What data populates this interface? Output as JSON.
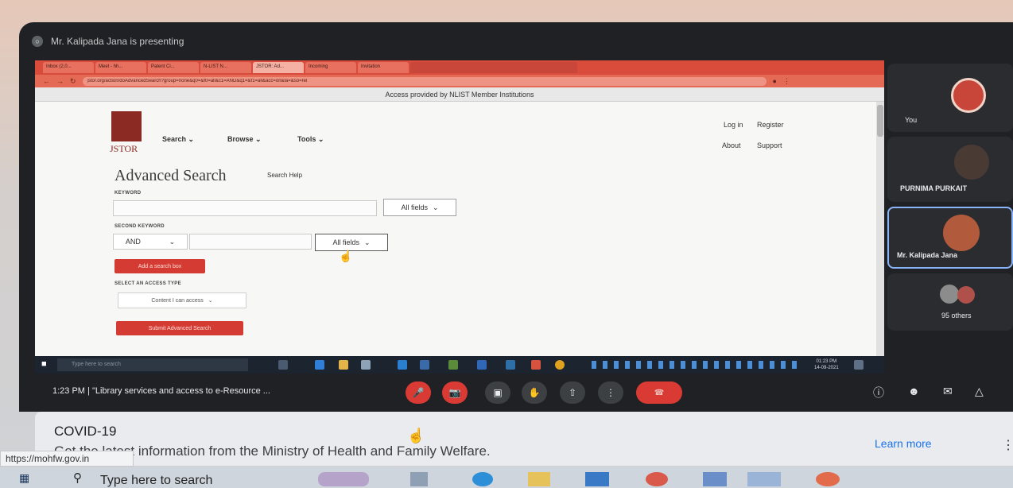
{
  "meet": {
    "presenting_text": "Mr. Kalipada Jana is presenting",
    "meeting_time": "1:23 PM",
    "meeting_separator": "|",
    "meeting_title": "\"Library services and access to e-Resource ...",
    "participants": [
      {
        "name": "You"
      },
      {
        "name": "PURNIMA PURKAIT"
      },
      {
        "name": "Mr. Kalipada Jana"
      },
      {
        "name": "95 others"
      }
    ],
    "end_call_label": "☎"
  },
  "browser": {
    "tabs": [
      "Inbox (2,0...",
      "Meet - hh...",
      "Patent Ci...",
      "N-LIST N...",
      "JSTOR: Ad...",
      "Incoming",
      "Invitation",
      ""
    ],
    "url": "jstor.org/action/doAdvancedSearch?group=none&q0=&f0=all&c1=AND&q1=&f1=all&acc=on&la=&so=rel"
  },
  "jstor": {
    "access_banner": "Access provided by NLIST Member Institutions",
    "logo_text": "JSTOR",
    "nav": {
      "search": "Search",
      "browse": "Browse",
      "tools": "Tools"
    },
    "top_links": {
      "login": "Log in",
      "register": "Register",
      "about": "About",
      "support": "Support"
    },
    "title": "Advanced Search",
    "search_help": "Search Help",
    "keyword_label": "KEYWORD",
    "field_1": "All fields",
    "second_keyword_label": "SECOND KEYWORD",
    "boolean_op": "AND",
    "field_2": "All fields",
    "add_box_label": "Add a search box",
    "access_type_label": "SELECT AN ACCESS TYPE",
    "access_type_value": "Content I can access",
    "submit_label": "Submit Advanced Search"
  },
  "inner_taskbar": {
    "search_placeholder": "Type here to search",
    "time": "01:23 PM",
    "date": "14-09-2021"
  },
  "banner": {
    "title": "COVID-19",
    "text": "Get the latest information from the Ministry of Health and Family Welfare.",
    "learn_more": "Learn more",
    "status_url": "https://mohfw.gov.in"
  },
  "host_taskbar": {
    "search_placeholder": "Type here to search"
  },
  "colors": {
    "jstor_red": "#d43c33",
    "meet_bg": "#202124",
    "end_call": "#d93b34"
  }
}
